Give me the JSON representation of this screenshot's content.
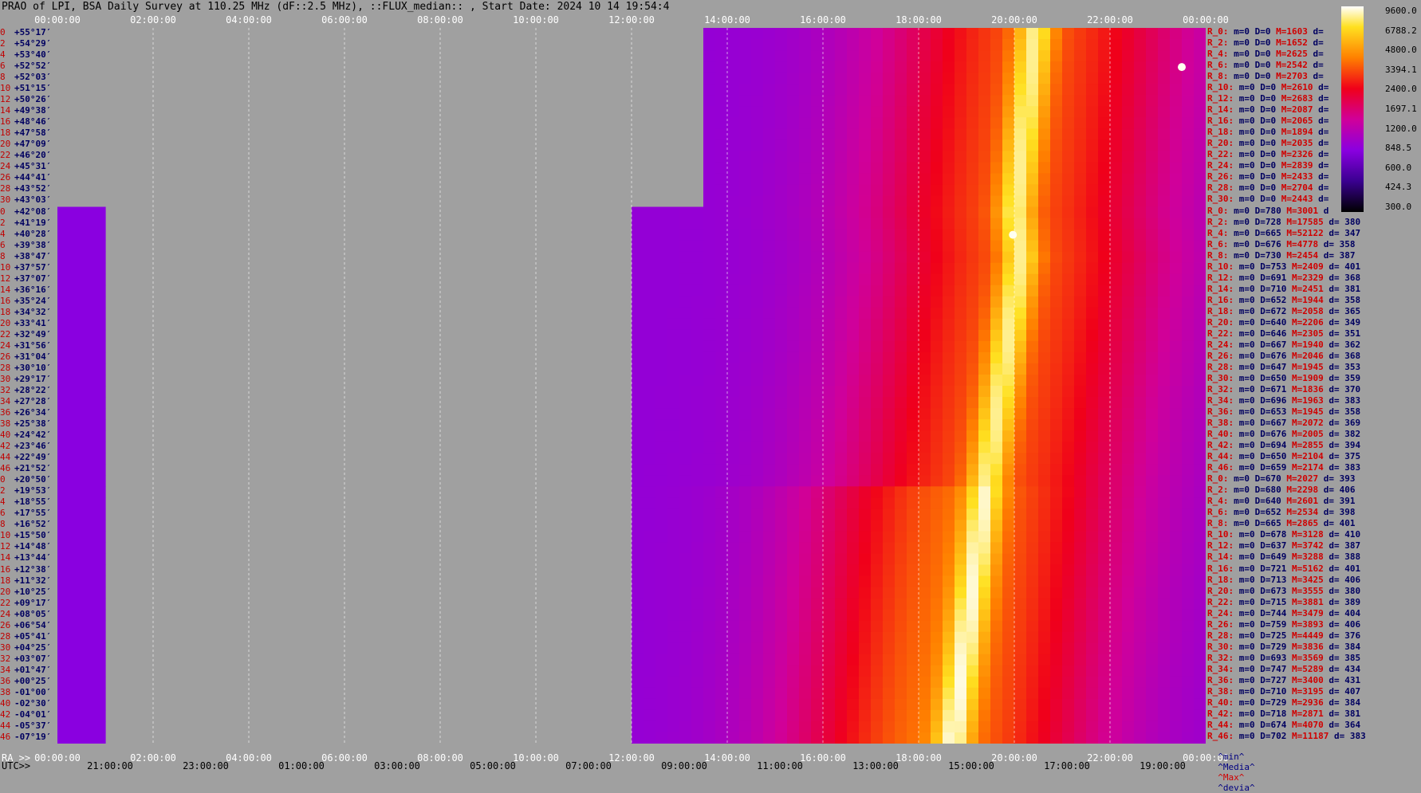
{
  "title": "PRAO of LPI, BSA Daily Survey at 110.25 MHz (dF::2.5 MHz), ::FLUX_median:: , Start Date: 2024 10 14 19:54:4",
  "top_axis": [
    "00:00:00",
    "02:00:00",
    "04:00:00",
    "06:00:00",
    "08:00:00",
    "10:00:00",
    "12:00:00",
    "14:00:00",
    "16:00:00",
    "18:00:00",
    "20:00:00",
    "22:00:00",
    "00:00:00"
  ],
  "bottom_axis_ra": [
    "00:00:00",
    "02:00:00",
    "04:00:00",
    "06:00:00",
    "08:00:00",
    "10:00:00",
    "12:00:00",
    "14:00:00",
    "16:00:00",
    "18:00:00",
    "20:00:00",
    "22:00:00",
    "00:00:00"
  ],
  "bottom_axis_utc": [
    "21:00:00",
    "23:00:00",
    "01:00:00",
    "03:00:00",
    "05:00:00",
    "07:00:00",
    "09:00:00",
    "11:00:00",
    "13:00:00",
    "15:00:00",
    "17:00:00",
    "19:00:00"
  ],
  "ra_label": "RA >>",
  "utc_label": "UTC>>",
  "declinations": [
    "+55°17′",
    "+54°29′",
    "+53°40′",
    "+52°52′",
    "+52°03′",
    "+51°15′",
    "+50°26′",
    "+49°38′",
    "+48°46′",
    "+47°58′",
    "+47°09′",
    "+46°20′",
    "+45°31′",
    "+44°41′",
    "+43°52′",
    "+43°03′",
    "+42°08′",
    "+41°19′",
    "+40°28′",
    "+39°38′",
    "+38°47′",
    "+37°57′",
    "+37°07′",
    "+36°16′",
    "+35°24′",
    "+34°32′",
    "+33°41′",
    "+32°49′",
    "+31°56′",
    "+31°04′",
    "+30°10′",
    "+29°17′",
    "+28°22′",
    "+27°28′",
    "+26°34′",
    "+25°38′",
    "+24°42′",
    "+23°46′",
    "+22°49′",
    "+21°52′",
    "+20°50′",
    "+19°53′",
    "+18°55′",
    "+17°55′",
    "+16°52′",
    "+15°50′",
    "+14°48′",
    "+13°44′",
    "+12°38′",
    "+11°32′",
    "+10°25′",
    "+09°17′",
    "+08°05′",
    "+06°54′",
    "+05°41′",
    "+04°25′",
    "+03°07′",
    "+01°47′",
    "+00°25′",
    "-01°00′",
    "-02°30′",
    "-04°01′",
    "-05°37′",
    "-07°19′"
  ],
  "row_index": [
    "0",
    "2",
    "4",
    "6",
    "8",
    "10",
    "12",
    "14",
    "16",
    "18",
    "20",
    "22",
    "24",
    "26",
    "28",
    "30",
    "0",
    "2",
    "4",
    "6",
    "8",
    "10",
    "12",
    "14",
    "16",
    "18",
    "20",
    "22",
    "24",
    "26",
    "28",
    "30",
    "32",
    "34",
    "36",
    "38",
    "40",
    "42",
    "44",
    "46",
    "0",
    "2",
    "4",
    "6",
    "8",
    "10",
    "12",
    "14",
    "16",
    "18",
    "20",
    "22",
    "24",
    "26",
    "28",
    "30",
    "32",
    "34",
    "36",
    "38",
    "40",
    "42",
    "44",
    "46"
  ],
  "stats": [
    {
      "r": "R_0:",
      "m": "m=0",
      "d": "D=0",
      "M": "M=1603",
      "dv": "d="
    },
    {
      "r": "R_2:",
      "m": "m=0",
      "d": "D=0",
      "M": "M=1652",
      "dv": "d="
    },
    {
      "r": "R_4:",
      "m": "m=0",
      "d": "D=0",
      "M": "M=2625",
      "dv": "d="
    },
    {
      "r": "R_6:",
      "m": "m=0",
      "d": "D=0",
      "M": "M=2542",
      "dv": "d="
    },
    {
      "r": "R_8:",
      "m": "m=0",
      "d": "D=0",
      "M": "M=2703",
      "dv": "d="
    },
    {
      "r": "R_10:",
      "m": "m=0",
      "d": "D=0",
      "M": "M=2610",
      "dv": "d="
    },
    {
      "r": "R_12:",
      "m": "m=0",
      "d": "D=0",
      "M": "M=2683",
      "dv": "d="
    },
    {
      "r": "R_14:",
      "m": "m=0",
      "d": "D=0",
      "M": "M=2087",
      "dv": "d="
    },
    {
      "r": "R_16:",
      "m": "m=0",
      "d": "D=0",
      "M": "M=2065",
      "dv": "d="
    },
    {
      "r": "R_18:",
      "m": "m=0",
      "d": "D=0",
      "M": "M=1894",
      "dv": "d="
    },
    {
      "r": "R_20:",
      "m": "m=0",
      "d": "D=0",
      "M": "M=2035",
      "dv": "d="
    },
    {
      "r": "R_22:",
      "m": "m=0",
      "d": "D=0",
      "M": "M=2326",
      "dv": "d="
    },
    {
      "r": "R_24:",
      "m": "m=0",
      "d": "D=0",
      "M": "M=2839",
      "dv": "d="
    },
    {
      "r": "R_26:",
      "m": "m=0",
      "d": "D=0",
      "M": "M=2433",
      "dv": "d="
    },
    {
      "r": "R_28:",
      "m": "m=0",
      "d": "D=0",
      "M": "M=2704",
      "dv": "d="
    },
    {
      "r": "R_30:",
      "m": "m=0",
      "d": "D=0",
      "M": "M=2443",
      "dv": "d="
    },
    {
      "r": "R_0:",
      "m": "m=0",
      "d": "D=780",
      "M": "M=3001",
      "dv": "d"
    },
    {
      "r": "R_2:",
      "m": "m=0",
      "d": "D=728",
      "M": "M=17585",
      "dv": "d= 380"
    },
    {
      "r": "R_4:",
      "m": "m=0",
      "d": "D=665",
      "M": "M=52122",
      "dv": "d= 347"
    },
    {
      "r": "R_6:",
      "m": "m=0",
      "d": "D=676",
      "M": "M=4778",
      "dv": "d= 358"
    },
    {
      "r": "R_8:",
      "m": "m=0",
      "d": "D=730",
      "M": "M=2454",
      "dv": "d= 387"
    },
    {
      "r": "R_10:",
      "m": "m=0",
      "d": "D=753",
      "M": "M=2409",
      "dv": "d= 401"
    },
    {
      "r": "R_12:",
      "m": "m=0",
      "d": "D=691",
      "M": "M=2329",
      "dv": "d= 368"
    },
    {
      "r": "R_14:",
      "m": "m=0",
      "d": "D=710",
      "M": "M=2451",
      "dv": "d= 381"
    },
    {
      "r": "R_16:",
      "m": "m=0",
      "d": "D=652",
      "M": "M=1944",
      "dv": "d= 358"
    },
    {
      "r": "R_18:",
      "m": "m=0",
      "d": "D=672",
      "M": "M=2058",
      "dv": "d= 365"
    },
    {
      "r": "R_20:",
      "m": "m=0",
      "d": "D=640",
      "M": "M=2206",
      "dv": "d= 349"
    },
    {
      "r": "R_22:",
      "m": "m=0",
      "d": "D=646",
      "M": "M=2305",
      "dv": "d= 351"
    },
    {
      "r": "R_24:",
      "m": "m=0",
      "d": "D=667",
      "M": "M=1940",
      "dv": "d= 362"
    },
    {
      "r": "R_26:",
      "m": "m=0",
      "d": "D=676",
      "M": "M=2046",
      "dv": "d= 368"
    },
    {
      "r": "R_28:",
      "m": "m=0",
      "d": "D=647",
      "M": "M=1945",
      "dv": "d= 353"
    },
    {
      "r": "R_30:",
      "m": "m=0",
      "d": "D=650",
      "M": "M=1909",
      "dv": "d= 359"
    },
    {
      "r": "R_32:",
      "m": "m=0",
      "d": "D=671",
      "M": "M=1836",
      "dv": "d= 370"
    },
    {
      "r": "R_34:",
      "m": "m=0",
      "d": "D=696",
      "M": "M=1963",
      "dv": "d= 383"
    },
    {
      "r": "R_36:",
      "m": "m=0",
      "d": "D=653",
      "M": "M=1945",
      "dv": "d= 358"
    },
    {
      "r": "R_38:",
      "m": "m=0",
      "d": "D=667",
      "M": "M=2072",
      "dv": "d= 369"
    },
    {
      "r": "R_40:",
      "m": "m=0",
      "d": "D=676",
      "M": "M=2005",
      "dv": "d= 382"
    },
    {
      "r": "R_42:",
      "m": "m=0",
      "d": "D=694",
      "M": "M=2855",
      "dv": "d= 394"
    },
    {
      "r": "R_44:",
      "m": "m=0",
      "d": "D=650",
      "M": "M=2104",
      "dv": "d= 375"
    },
    {
      "r": "R_46:",
      "m": "m=0",
      "d": "D=659",
      "M": "M=2174",
      "dv": "d= 383"
    },
    {
      "r": "R_0:",
      "m": "m=0",
      "d": "D=670",
      "M": "M=2027",
      "dv": "d= 393"
    },
    {
      "r": "R_2:",
      "m": "m=0",
      "d": "D=680",
      "M": "M=2298",
      "dv": "d= 406"
    },
    {
      "r": "R_4:",
      "m": "m=0",
      "d": "D=640",
      "M": "M=2601",
      "dv": "d= 391"
    },
    {
      "r": "R_6:",
      "m": "m=0",
      "d": "D=652",
      "M": "M=2534",
      "dv": "d= 398"
    },
    {
      "r": "R_8:",
      "m": "m=0",
      "d": "D=665",
      "M": "M=2865",
      "dv": "d= 401"
    },
    {
      "r": "R_10:",
      "m": "m=0",
      "d": "D=678",
      "M": "M=3128",
      "dv": "d= 410"
    },
    {
      "r": "R_12:",
      "m": "m=0",
      "d": "D=637",
      "M": "M=3742",
      "dv": "d= 387"
    },
    {
      "r": "R_14:",
      "m": "m=0",
      "d": "D=649",
      "M": "M=3288",
      "dv": "d= 388"
    },
    {
      "r": "R_16:",
      "m": "m=0",
      "d": "D=721",
      "M": "M=5162",
      "dv": "d= 401"
    },
    {
      "r": "R_18:",
      "m": "m=0",
      "d": "D=713",
      "M": "M=3425",
      "dv": "d= 406"
    },
    {
      "r": "R_20:",
      "m": "m=0",
      "d": "D=673",
      "M": "M=3555",
      "dv": "d= 380"
    },
    {
      "r": "R_22:",
      "m": "m=0",
      "d": "D=715",
      "M": "M=3881",
      "dv": "d= 389"
    },
    {
      "r": "R_24:",
      "m": "m=0",
      "d": "D=744",
      "M": "M=3479",
      "dv": "d= 404"
    },
    {
      "r": "R_26:",
      "m": "m=0",
      "d": "D=759",
      "M": "M=3893",
      "dv": "d= 406"
    },
    {
      "r": "R_28:",
      "m": "m=0",
      "d": "D=725",
      "M": "M=4449",
      "dv": "d= 376"
    },
    {
      "r": "R_30:",
      "m": "m=0",
      "d": "D=729",
      "M": "M=3836",
      "dv": "d= 384"
    },
    {
      "r": "R_32:",
      "m": "m=0",
      "d": "D=693",
      "M": "M=3569",
      "dv": "d= 385"
    },
    {
      "r": "R_34:",
      "m": "m=0",
      "d": "D=747",
      "M": "M=5289",
      "dv": "d= 434"
    },
    {
      "r": "R_36:",
      "m": "m=0",
      "d": "D=727",
      "M": "M=3400",
      "dv": "d= 431"
    },
    {
      "r": "R_38:",
      "m": "m=0",
      "d": "D=710",
      "M": "M=3195",
      "dv": "d= 407"
    },
    {
      "r": "R_40:",
      "m": "m=0",
      "d": "D=729",
      "M": "M=2936",
      "dv": "d= 384"
    },
    {
      "r": "R_42:",
      "m": "m=0",
      "d": "D=718",
      "M": "M=2871",
      "dv": "d= 381"
    },
    {
      "r": "R_44:",
      "m": "m=0",
      "d": "D=674",
      "M": "M=4070",
      "dv": "d= 364"
    },
    {
      "r": "R_46:",
      "m": "m=0",
      "d": "D=702",
      "M": "M=11187",
      "dv": "d= 383"
    }
  ],
  "footer": {
    "min": "^min^",
    "median": "^Media^",
    "max": "^Max^",
    "devia": "^devia^"
  },
  "colorbar": {
    "ticks": [
      "9600.0",
      "6788.2",
      "4800.0",
      "3394.1",
      "2400.0",
      "1697.1",
      "1200.0",
      "848.5",
      "600.0",
      "424.3",
      "300.0"
    ],
    "min": 300,
    "max": 9600,
    "scale": "log"
  },
  "chart_data": {
    "type": "heatmap",
    "title": "PRAO of LPI, BSA Daily Survey at 110.25 MHz (dF::2.5 MHz), ::FLUX_median:: , Start Date: 2024 10 14 19:54:4",
    "xlabel": "RA / UTC",
    "x_range_ra_hours": [
      0,
      24
    ],
    "n_rows": 64,
    "colorbar_range": [
      300,
      9600
    ],
    "colorbar_scale": "log",
    "sections": [
      {
        "rows": [
          0,
          15
        ],
        "ra_start_hours": 13.4,
        "ra_end_hours": 24
      },
      {
        "rows": [
          16,
          63
        ],
        "ra_start_hours": 0,
        "ra_end_hours": 0.9
      },
      {
        "rows": [
          16,
          63
        ],
        "ra_start_hours": 12.0,
        "ra_end_hours": 24
      }
    ],
    "galactic_plane_track": [
      {
        "row": 0,
        "ra_hours": 20.3
      },
      {
        "row": 16,
        "ra_hours": 19.9
      },
      {
        "row": 20,
        "ra_hours": 20.0
      },
      {
        "row": 40,
        "ra_hours": 19.3
      },
      {
        "row": 63,
        "ra_hours": 18.6
      }
    ],
    "point_sources": [
      {
        "row": 18,
        "ra_hours": 19.97,
        "label": "bright source"
      },
      {
        "row": 3,
        "ra_hours": 23.5
      }
    ]
  }
}
